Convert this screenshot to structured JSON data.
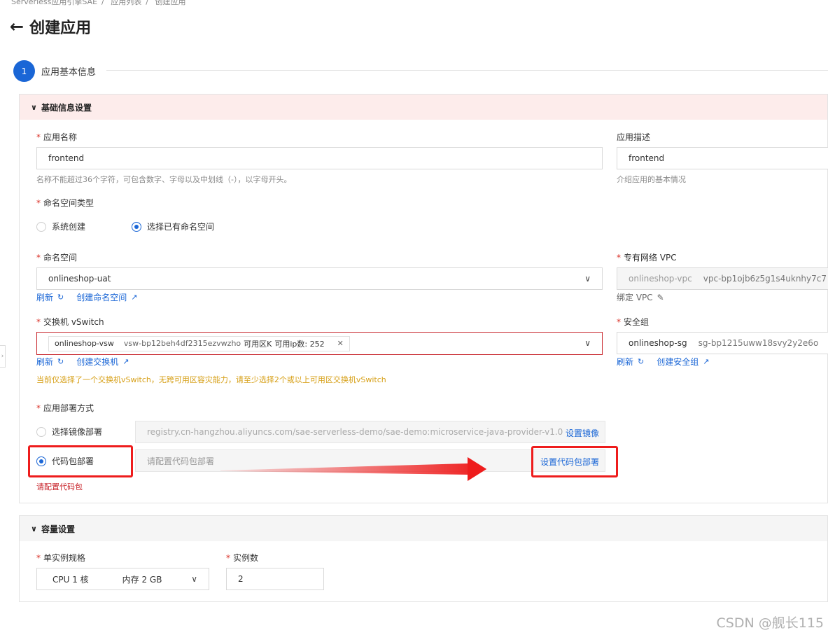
{
  "breadcrumb": [
    "Serverless应用引擎SAE",
    "应用列表",
    "创建应用"
  ],
  "page": {
    "back_icon": "arrow-left-icon",
    "title": "创建应用"
  },
  "step": {
    "number": "1",
    "label": "应用基本信息"
  },
  "basic": {
    "section_title": "基础信息设置",
    "app_name": {
      "label": "应用名称",
      "value": "frontend",
      "help": "名称不能超过36个字符，可包含数字、字母以及中划线（-），以字母开头。"
    },
    "app_desc": {
      "label": "应用描述",
      "value": "frontend",
      "help": "介绍应用的基本情况"
    },
    "ns_type": {
      "label": "命名空间类型",
      "options": [
        "系统创建",
        "选择已有命名空间"
      ],
      "selected": 1
    },
    "namespace": {
      "label": "命名空间",
      "value": "onlineshop-uat",
      "refresh": "刷新",
      "create": "创建命名空间"
    },
    "vpc": {
      "label": "专有网络 VPC",
      "name": "onlineshop-vpc",
      "id": "vpc-bp1ojb6z5g1s4uknhy7c7",
      "bind": "绑定 VPC"
    },
    "vswitch": {
      "label": "交换机 vSwitch",
      "tag_name": "onlineshop-vsw",
      "tag_id": "vsw-bp12beh4df2315ezvwzho",
      "tag_zone": "可用区K",
      "tag_ip": "可用ip数: 252",
      "refresh": "刷新",
      "create": "创建交换机",
      "warning": "当前仅选择了一个交换机vSwitch，无跨可用区容灾能力，请至少选择2个或以上可用区交换机vSwitch"
    },
    "security_group": {
      "label": "安全组",
      "name": "onlineshop-sg",
      "id": "sg-bp1215uww18svy2y2e6o",
      "refresh": "刷新",
      "create": "创建安全组"
    },
    "deploy": {
      "label": "应用部署方式",
      "image_option": "选择镜像部署",
      "image_value": "registry.cn-hangzhou.aliyuncs.com/sae-serverless-demo/sae-demo:microservice-java-provider-v1.0",
      "image_button": "设置镜像",
      "code_option": "代码包部署",
      "code_placeholder": "请配置代码包部署",
      "code_button": "设置代码包部署",
      "error": "请配置代码包",
      "selected": "code"
    }
  },
  "capacity": {
    "section_title": "容量设置",
    "spec": {
      "label": "单实例规格",
      "cpu": "CPU 1 核",
      "mem": "内存 2 GB"
    },
    "instances": {
      "label": "实例数",
      "value": "2"
    }
  },
  "watermark": "CSDN @舰长115",
  "colors": {
    "primary": "#1a66d6",
    "annotation": "#ee1c1c",
    "required": "#d93026",
    "warning": "#d7a018"
  }
}
